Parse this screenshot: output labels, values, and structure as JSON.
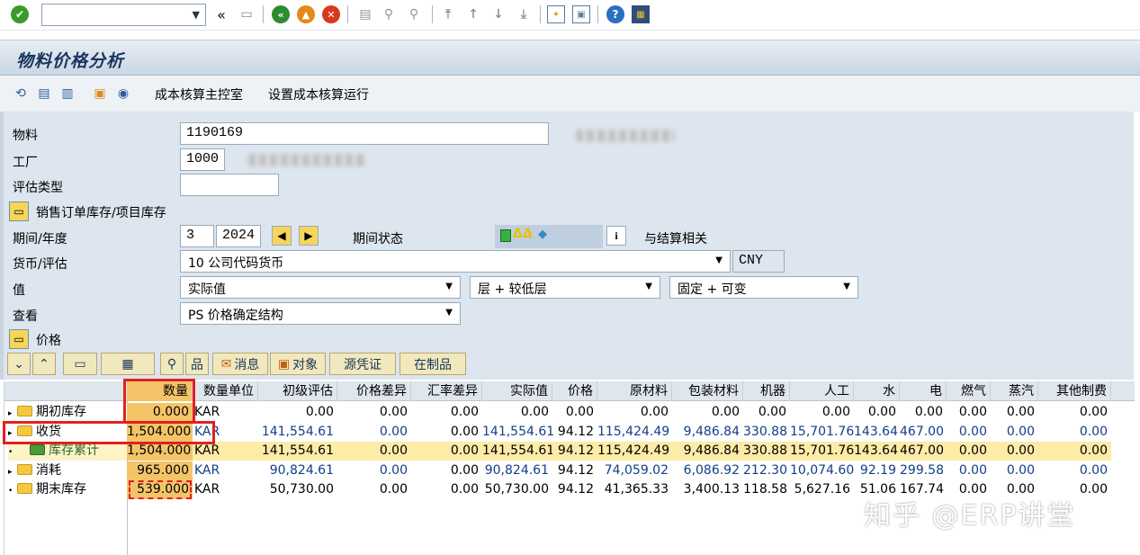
{
  "toolbar": {
    "command_value": "",
    "back_glyph": "«"
  },
  "title": "物料价格分析",
  "app_toolbar": {
    "cockpit": "成本核算主控室",
    "setup_run": "设置成本核算运行"
  },
  "form": {
    "material_label": "物料",
    "material_value": "1190169",
    "plant_label": "工厂",
    "plant_value": "1000",
    "valuation_type_label": "评估类型",
    "valuation_type_value": "",
    "sales_stock_label": "销售订单库存/项目库存",
    "period_label": "期间/年度",
    "period_value": "3",
    "year_value": "2024",
    "period_status_label": "期间状态",
    "settlement_label": "与结算相关",
    "currency_label": "货币/评估",
    "currency_value": "10 公司代码货币",
    "currency_code": "CNY",
    "value_label": "值",
    "value_select": "实际值",
    "level_select": "层 + 较低层",
    "fixvar_select": "固定 + 可变",
    "view_label": "查看",
    "view_select": "PS 价格确定结构",
    "price_label": "价格"
  },
  "grid_buttons": {
    "messages": "消息",
    "objects": "对象",
    "source_doc": "源凭证",
    "wip": "在制品"
  },
  "columns": [
    "数量",
    "数量单位",
    "初级评估",
    "价格差异",
    "汇率差异",
    "实际值",
    "价格",
    "原材料",
    "包装材料",
    "机器",
    "人工",
    "水",
    "电",
    "燃气",
    "蒸汽",
    "其他制费"
  ],
  "rows": [
    {
      "label": "期初库存",
      "exp": "▸",
      "cells": [
        "0.000",
        "KAR",
        "0.00",
        "0.00",
        "0.00",
        "0.00",
        "0.00",
        "0.00",
        "0.00",
        "0.00",
        "0.00",
        "0.00",
        "0.00",
        "0.00",
        "0.00",
        "0.00"
      ]
    },
    {
      "label": "收货",
      "exp": "▸",
      "cells": [
        "1,504.000",
        "KAR",
        "141,554.61",
        "0.00",
        "0.00",
        "141,554.61",
        "94.12",
        "115,424.49",
        "9,486.84",
        "330.88",
        "15,701.76",
        "143.64",
        "467.00",
        "0.00",
        "0.00",
        "0.00"
      ]
    },
    {
      "label": "库存累计",
      "exp": "•",
      "cells": [
        "1,504.000",
        "KAR",
        "141,554.61",
        "0.00",
        "0.00",
        "141,554.61",
        "94.12",
        "115,424.49",
        "9,486.84",
        "330.88",
        "15,701.76",
        "143.64",
        "467.00",
        "0.00",
        "0.00",
        "0.00"
      ]
    },
    {
      "label": "消耗",
      "exp": "▸",
      "cells": [
        "965.000",
        "KAR",
        "90,824.61",
        "0.00",
        "0.00",
        "90,824.61",
        "94.12",
        "74,059.02",
        "6,086.92",
        "212.30",
        "10,074.60",
        "92.19",
        "299.58",
        "0.00",
        "0.00",
        "0.00"
      ]
    },
    {
      "label": "期末库存",
      "exp": "•",
      "cells": [
        "539.000",
        "KAR",
        "50,730.00",
        "0.00",
        "0.00",
        "50,730.00",
        "94.12",
        "41,365.33",
        "3,400.13",
        "118.58",
        "5,627.16",
        "51.06",
        "167.74",
        "0.00",
        "0.00",
        "0.00"
      ]
    }
  ],
  "watermark": "知乎 @ERP讲堂"
}
